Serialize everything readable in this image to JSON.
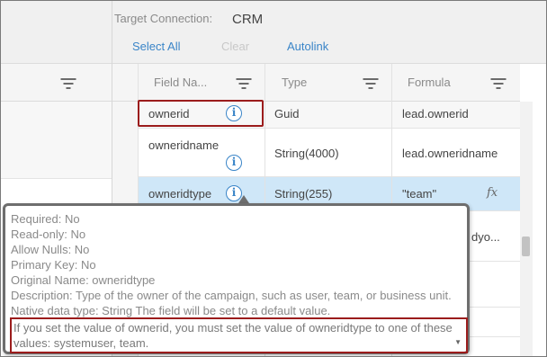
{
  "toolbar": {
    "target_label": "Target Connection:",
    "target_value": "CRM",
    "select_all": "Select All",
    "clear": "Clear",
    "autolink": "Autolink"
  },
  "columns": {
    "field_name": "Field Na...",
    "type": "Type",
    "formula": "Formula"
  },
  "rows": [
    {
      "field": "ownerid",
      "type": "Guid",
      "formula": "lead.ownerid"
    },
    {
      "field": "owneridname",
      "type": "String(4000)",
      "formula": "lead.owneridname"
    },
    {
      "field": "owneridtype",
      "type": "String(255)",
      "formula": "\"team\""
    },
    {
      "field": "",
      "type": "",
      "formula": "dyo..."
    }
  ],
  "icons": {
    "info": "info-icon",
    "function": "fx-icon",
    "filter": "filter-icon"
  },
  "fx_glyph": "fx",
  "info_glyph": "i",
  "tooltip": {
    "lines": [
      "Required: No",
      "Read-only: No",
      "Allow Nulls: No",
      "Primary Key: No",
      "Original Name: owneridtype"
    ],
    "description": "Description: Type of the owner of the campaign, such as user, team, or business unit. Native data type: String The field will be set to a default value.",
    "warning": "If you set the value of ownerid, you must set the value of owneridtype to one of these values: systemuser, team."
  },
  "colors": {
    "link": "#3a85c8",
    "selected_row": "#cfe7f8",
    "highlight_border": "#9b1c1c"
  }
}
